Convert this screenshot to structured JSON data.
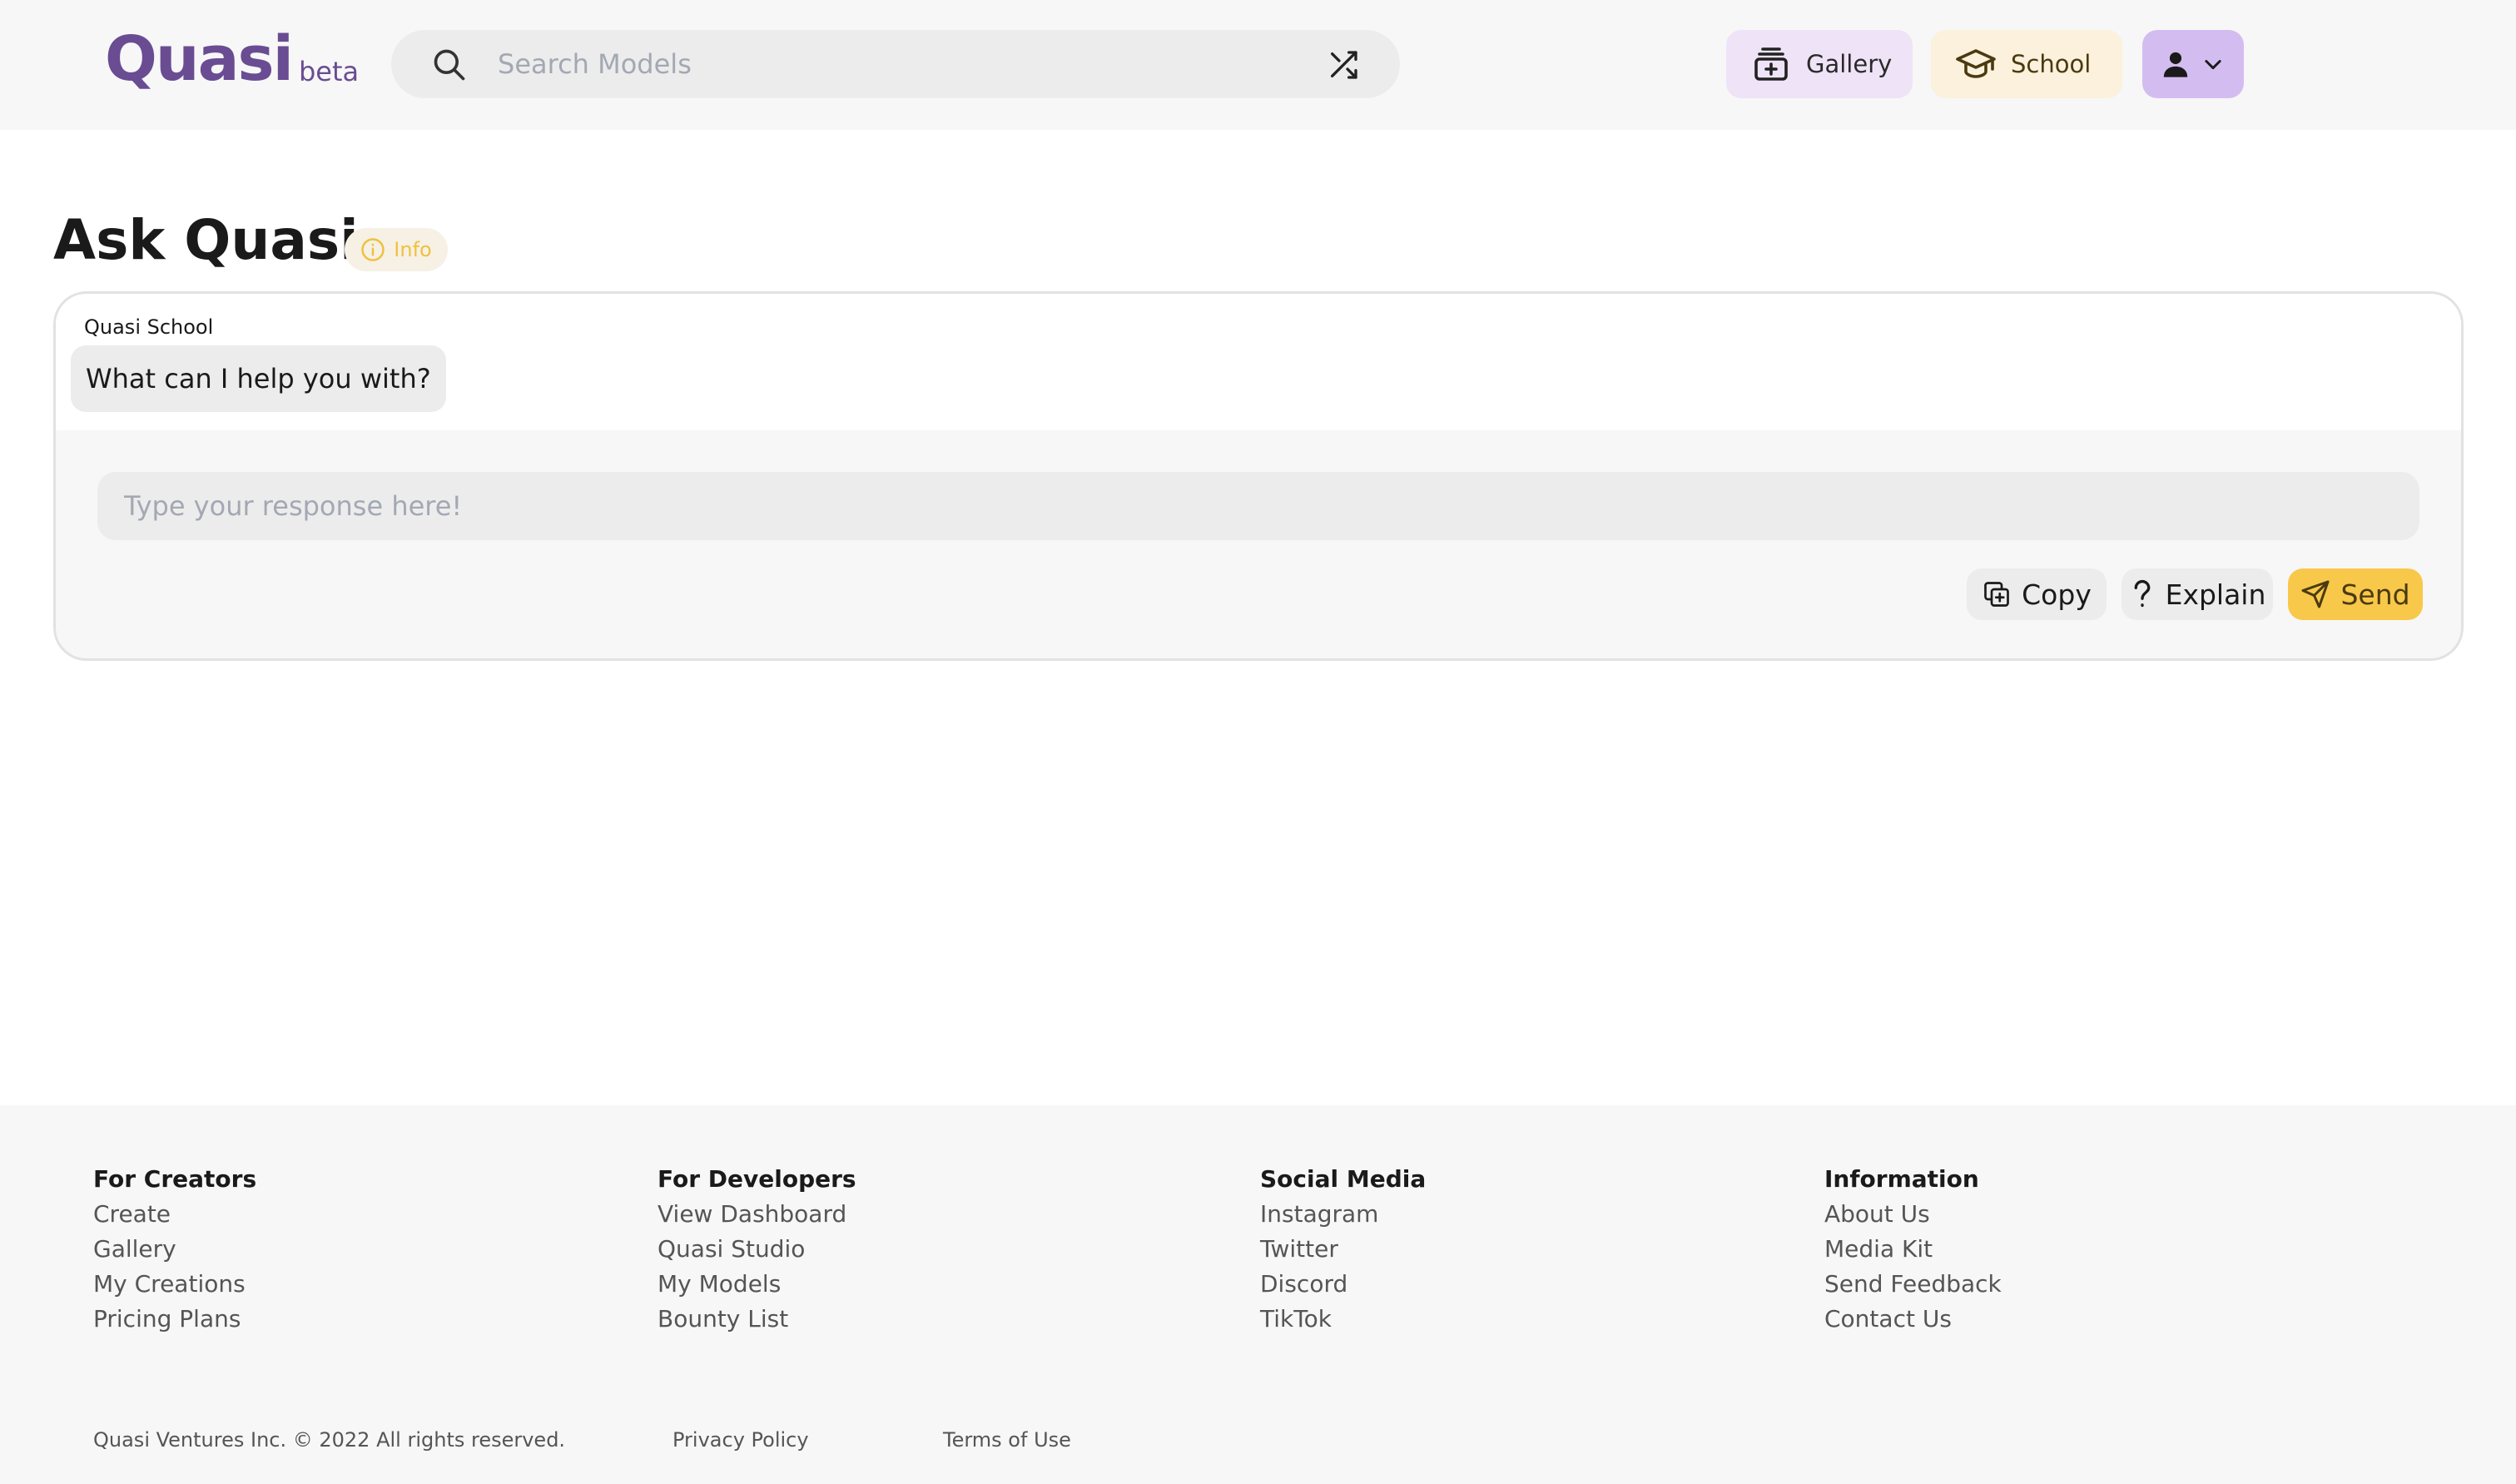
{
  "header": {
    "logo_text": "Quasi",
    "logo_badge": "beta",
    "search": {
      "placeholder": "Search Models",
      "value": ""
    },
    "nav": {
      "gallery_label": "Gallery",
      "school_label": "School"
    }
  },
  "main": {
    "title": "Ask Quasi",
    "info_label": "Info",
    "chat": {
      "sender": "Quasi School",
      "message": "What can I help you with?",
      "input_placeholder": "Type your response here!",
      "input_value": "",
      "actions": {
        "copy_label": "Copy",
        "explain_label": "Explain",
        "send_label": "Send"
      }
    }
  },
  "footer": {
    "columns": [
      {
        "heading": "For Creators",
        "links": [
          "Create",
          "Gallery",
          "My Creations",
          "Pricing Plans"
        ]
      },
      {
        "heading": "For Developers",
        "links": [
          "View Dashboard",
          "Quasi Studio",
          "My Models",
          "Bounty List"
        ]
      },
      {
        "heading": "Social Media",
        "links": [
          "Instagram",
          "Twitter",
          "Discord",
          "TikTok"
        ]
      },
      {
        "heading": "Information",
        "links": [
          "About Us",
          "Media Kit",
          "Send Feedback",
          "Contact Us"
        ]
      }
    ],
    "copyright": "Quasi Ventures Inc. © 2022 All rights reserved.",
    "privacy_label": "Privacy Policy",
    "terms_label": "Terms of Use"
  },
  "colors": {
    "brand_purple": "#6a4c93",
    "accent_yellow": "#f8c84a",
    "gallery_bg": "#efe3f7",
    "school_bg": "#fbf1dc",
    "account_bg": "#d3bdf0"
  },
  "icons": [
    "search-icon",
    "shuffle-icon",
    "gallery-icon",
    "graduation-cap-icon",
    "user-icon",
    "chevron-down-icon",
    "info-icon",
    "copy-icon",
    "question-icon",
    "send-icon"
  ]
}
